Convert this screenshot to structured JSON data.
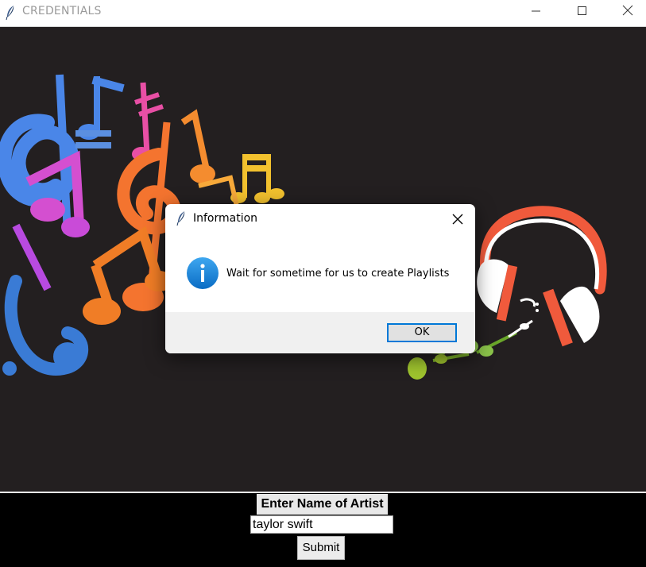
{
  "window": {
    "title": "CREDENTIALS",
    "minimize_icon": "minimize-icon",
    "maximize_icon": "maximize-icon",
    "close_icon": "close-icon"
  },
  "hero": {
    "background": "#231f20",
    "image": "music-notes-and-headphones"
  },
  "form": {
    "artist_label": "Enter Name of Artist",
    "artist_value": "taylor swift",
    "submit_label": "Submit"
  },
  "dialog": {
    "title": "Information",
    "message": "Wait for sometime for us to create Playlists",
    "ok_label": "OK",
    "icon": "info-icon",
    "accent": "#0078d7"
  }
}
